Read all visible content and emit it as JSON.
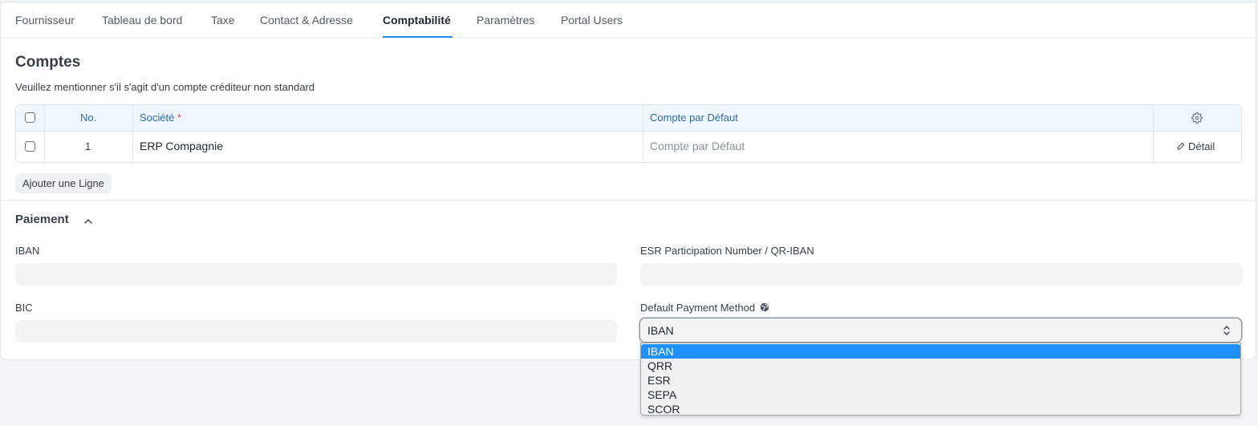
{
  "tabs": [
    {
      "label": "Fournisseur",
      "active": false
    },
    {
      "label": "Tableau de bord",
      "active": false
    },
    {
      "label": "Taxe",
      "active": false
    },
    {
      "label": "Contact & Adresse",
      "active": false
    },
    {
      "label": "Comptabilité",
      "active": true
    },
    {
      "label": "Paramètres",
      "active": false
    },
    {
      "label": "Portal Users",
      "active": false
    }
  ],
  "accounts": {
    "title": "Comptes",
    "description": "Veuillez mentionner s'il s'agit d'un compte créditeur non standard",
    "columns": {
      "no": "No.",
      "company": "Société",
      "required_mark": "*",
      "default_account": "Compte par Défaut"
    },
    "rows": [
      {
        "no": "1",
        "company": "ERP Compagnie",
        "default_account_placeholder": "Compte par Défaut",
        "detail_label": "Détail"
      }
    ],
    "add_row_label": "Ajouter une Ligne"
  },
  "payment": {
    "title": "Paiement",
    "iban_label": "IBAN",
    "iban_value": "",
    "esr_label": "ESR Participation Number / QR-IBAN",
    "esr_value": "",
    "bic_label": "BIC",
    "bic_value": "",
    "method_label": "Default Payment Method",
    "method_value": "IBAN",
    "method_options": [
      "IBAN",
      "QRR",
      "ESR",
      "SEPA",
      "SCOR"
    ],
    "selected_option_index": 0
  },
  "colors": {
    "accent": "#2490ef",
    "header_text": "#2b6cb0",
    "required": "#e24c4c",
    "option_highlight": "#1e90ff"
  }
}
